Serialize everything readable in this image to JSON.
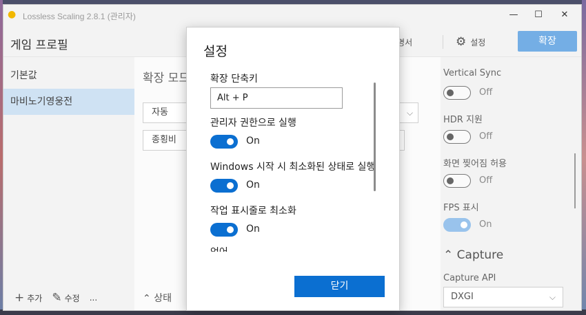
{
  "window": {
    "title": "Lossless Scaling 2.8.1 (관리자)",
    "minimize_glyph": "—",
    "maximize_glyph": "☐",
    "close_glyph": "✕"
  },
  "header": {
    "profile_title": "게임 프로필",
    "manual_link": "설명서",
    "settings_link": "설정",
    "scale_button": "확장"
  },
  "sidebar": {
    "items": [
      {
        "label": "기본값",
        "selected": false
      },
      {
        "label": "마비노기영웅전",
        "selected": true
      }
    ],
    "add_label": "추가",
    "edit_label": "수정",
    "more_label": "..."
  },
  "main": {
    "section_title": "확장 모드",
    "mode_value": "자동",
    "ratio_value": "종횡비",
    "status_toggle": "상태"
  },
  "right_panel": {
    "vsync_label": "Vertical Sync",
    "vsync_state": "Off",
    "hdr_label": "HDR 지원",
    "hdr_state": "Off",
    "tearing_label": "화면 찢어짐 허용",
    "tearing_state": "Off",
    "fps_label": "FPS 표시",
    "fps_state": "On",
    "capture_section": "Capture",
    "capture_api_label": "Capture API",
    "capture_api_value": "DXGI"
  },
  "dialog": {
    "title": "설정",
    "hotkey_label": "확장 단축키",
    "hotkey_value": "Alt + P",
    "admin_label": "관리자 권한으로 실행",
    "admin_state": "On",
    "startup_label": "Windows 시작 시 최소화된 상태로 실행",
    "startup_state": "On",
    "tray_label": "작업 표시줄로 최소화",
    "tray_state": "On",
    "cutoff_label": "언어",
    "close_button": "닫기"
  },
  "colors": {
    "accent": "#0b6fd1",
    "accent_light": "#74aee5",
    "selected_bg": "#cfe2f3"
  }
}
